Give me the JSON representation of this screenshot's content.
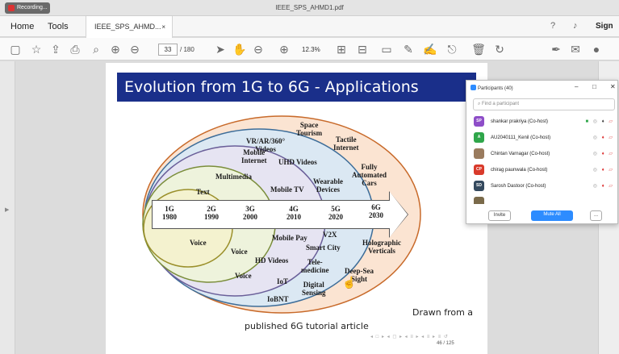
{
  "window": {
    "title": "IEEE_SPS_AHMD1.pdf",
    "recording": "Recording..."
  },
  "menu": {
    "home": "Home",
    "tools": "Tools",
    "tab_label": "IEEE_SPS_AHMD...",
    "tab_close": "×",
    "sign_in": "Sign In"
  },
  "toolbar": {
    "page_current": "33",
    "page_total": "/ 180",
    "zoom": "12.3%"
  },
  "slide": {
    "title": "Evolution from 1G to 6G - Applications",
    "gens": [
      {
        "g": "1G",
        "y": "1980"
      },
      {
        "g": "2G",
        "y": "1990"
      },
      {
        "g": "3G",
        "y": "2000"
      },
      {
        "g": "4G",
        "y": "2010"
      },
      {
        "g": "5G",
        "y": "2020"
      },
      {
        "g": "6G",
        "y": "2030"
      }
    ],
    "labels": {
      "text": "Text",
      "multimedia": "Multimedia",
      "mobile_internet": "Mobile\nInternet",
      "vr": "VR/AR/360°\nVideos",
      "space": "Space\nTourism",
      "tactile": "Tactile\nInternet",
      "uhd": "UHD Videos",
      "fully": "Fully\nAutomated\nCars",
      "wearable": "Wearable\nDevices",
      "mobile_tv": "Mobile TV",
      "voice1": "Voice",
      "voice2": "Voice",
      "voice3": "Voice",
      "mobile_pay": "Mobile Pay",
      "v2x": "V2X",
      "smart_city": "Smart City",
      "holographic": "Holographic\nVerticals",
      "hd": "HD Videos",
      "tele": "Tele-\nmedicine",
      "deep_sea": "Deep-Sea\nSight",
      "iot": "IoT",
      "digital": "Digital\nSensing",
      "iobnt": "IoBNT"
    },
    "caption1": "Drawn from a",
    "caption2": "published 6G tutorial article",
    "page_num": "46 / 125"
  },
  "participants": {
    "title": "Participants (40)",
    "search_placeholder": "Find a participant",
    "rows": [
      {
        "initials": "SP",
        "name": "shankar prakriya (Co-host)",
        "color": "#8e4dc8"
      },
      {
        "initials": "A",
        "name": "AU2040111_Kenil (Co-host)",
        "color": "#2fa64a"
      },
      {
        "initials": "",
        "name": "Chintan Varnagar (Co-host)",
        "color": "#9a7b5e"
      },
      {
        "initials": "CP",
        "name": "chirag paunwala (Co-host)",
        "color": "#d93a2b"
      },
      {
        "initials": "SD",
        "name": "Sarosh Dastoor (Co-host)",
        "color": "#34495e"
      }
    ],
    "invite": "Invite",
    "mute_all": "Mute All",
    "more": "..."
  },
  "colors": {
    "slide_header": "#1a2f8a",
    "zoom_blue": "#2d8cff"
  }
}
